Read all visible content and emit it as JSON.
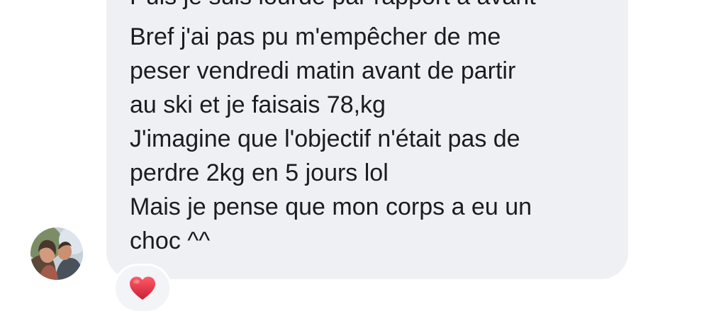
{
  "conversation": {
    "message_lines": {
      "partial_top": "Puis je suis lourde par rapport à avant",
      "message_1": [
        "Bref j'ai pas pu m'empêcher de me",
        "peser vendredi matin avant de partir",
        "au ski et je faisais 78,kg"
      ],
      "message_2": [
        "J'imagine que l'objectif n'était pas de",
        "perdre 2kg en 5 jours lol"
      ],
      "message_3": [
        "Mais je pense que mon corps a eu un",
        "choc ^^"
      ]
    },
    "reaction": {
      "icon": "heart-icon",
      "color": "#d72638"
    },
    "colors": {
      "bubble": "#eff0f3",
      "text": "#1c1c1e",
      "reaction_background": "#f3f4f7"
    }
  }
}
